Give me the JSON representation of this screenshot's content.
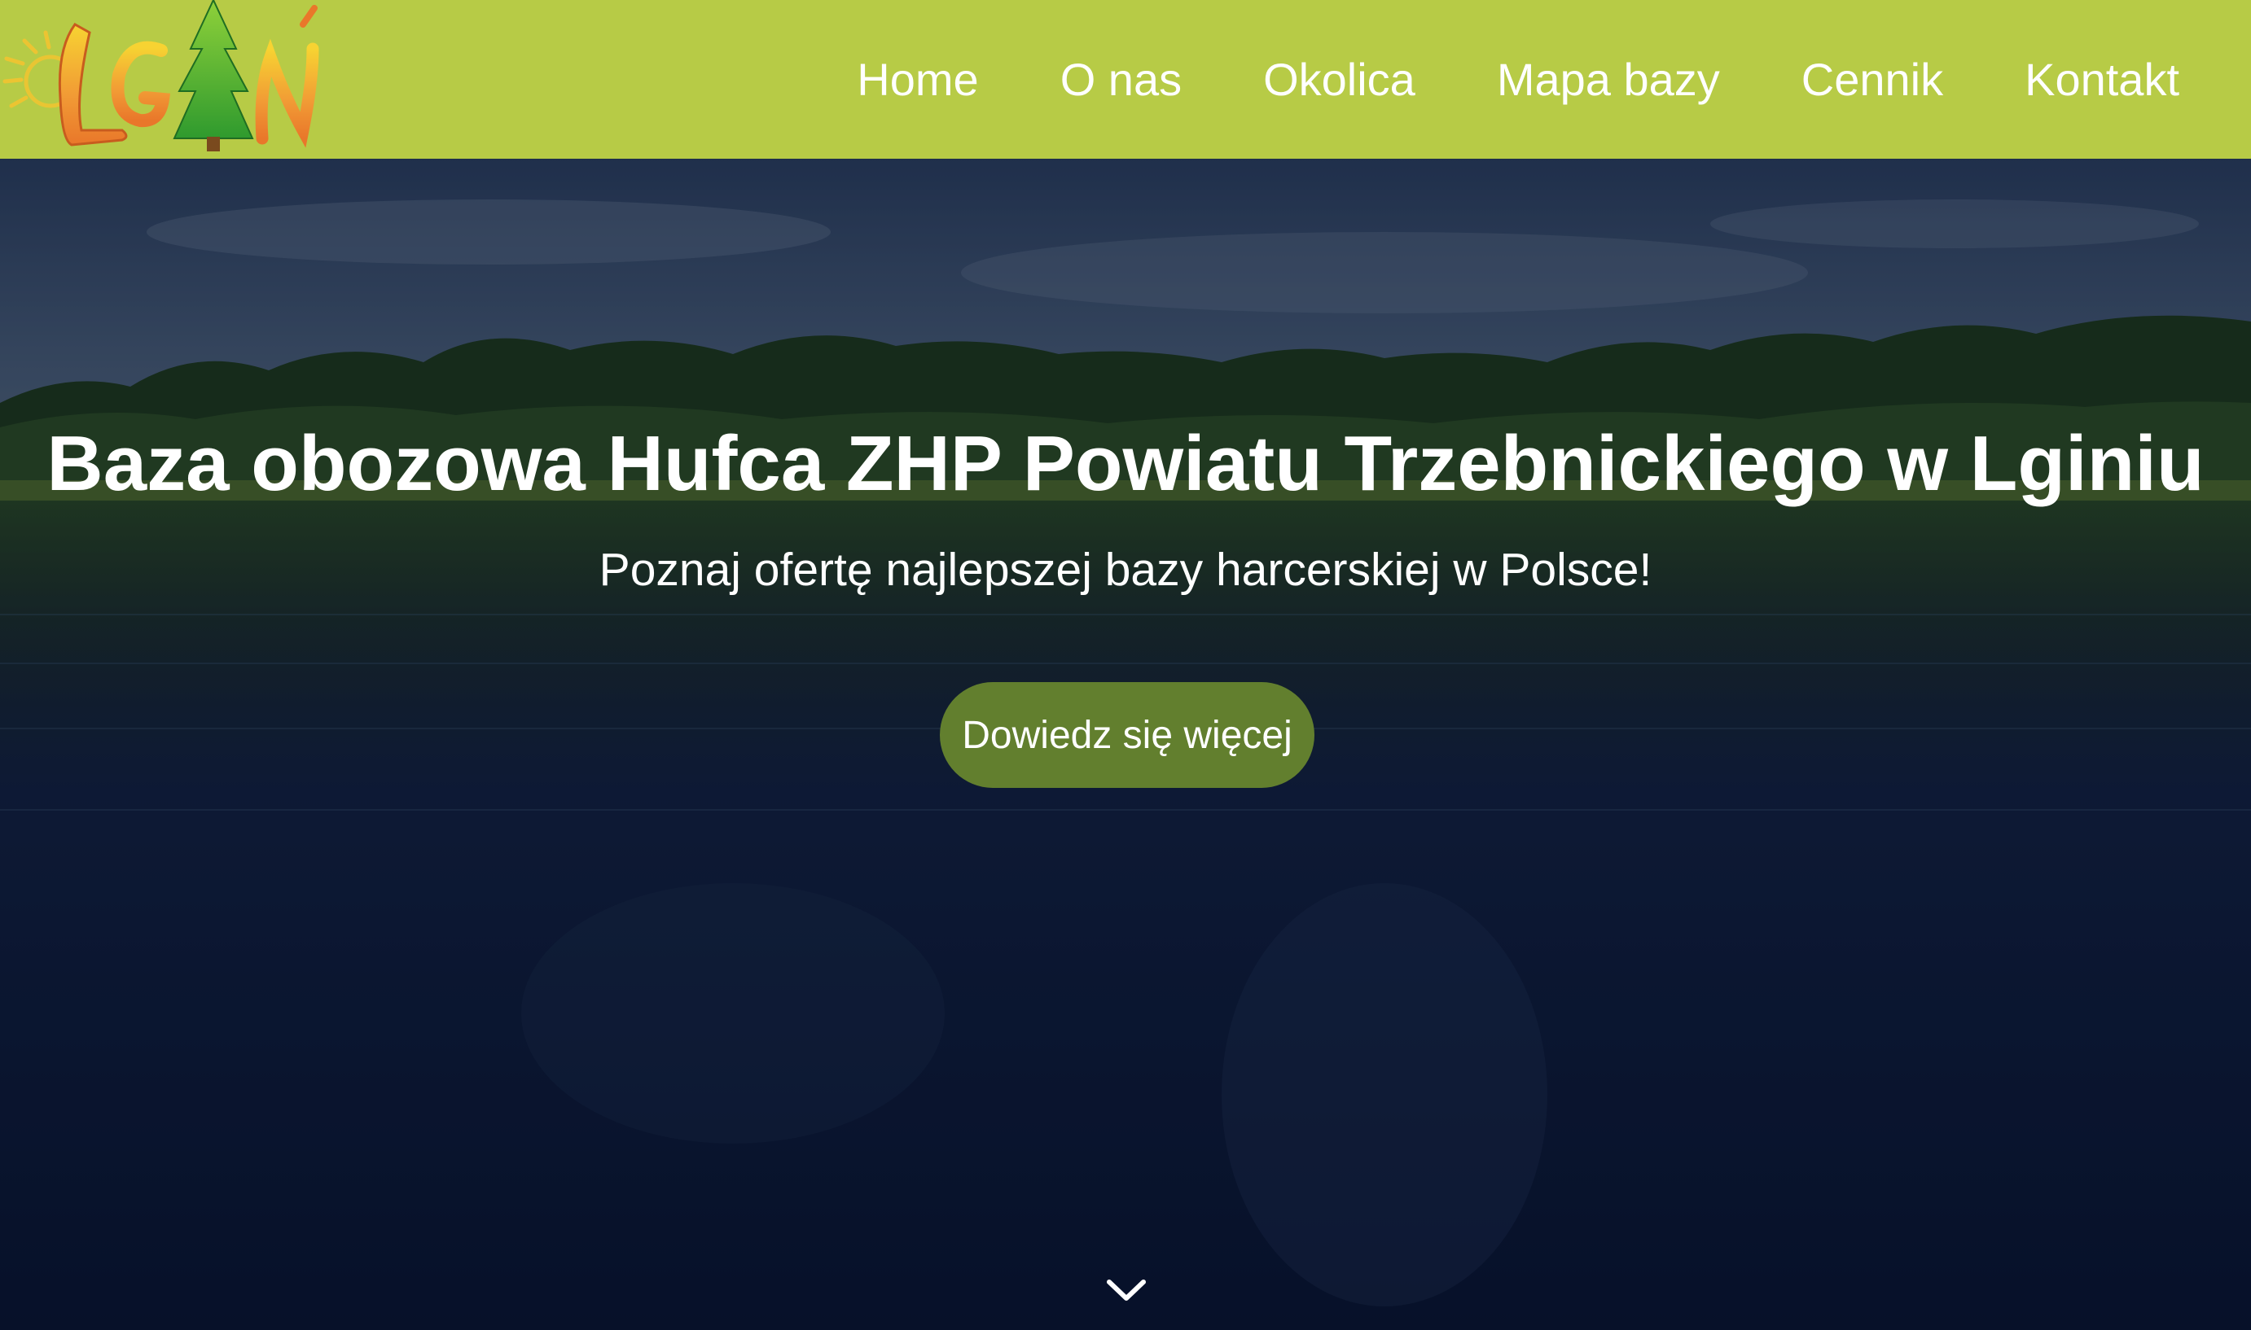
{
  "header": {
    "logo_text": "LGIŃ",
    "nav": [
      {
        "label": "Home"
      },
      {
        "label": "O nas"
      },
      {
        "label": "Okolica"
      },
      {
        "label": "Mapa bazy"
      },
      {
        "label": "Cennik"
      },
      {
        "label": "Kontakt"
      }
    ]
  },
  "hero": {
    "title": "Baza obozowa Hufca ZHP Powiatu Trzebnickiego w Lginiu",
    "subtitle": "Poznaj ofertę najlepszej bazy harcerskiej w Polsce!",
    "cta_label": "Dowiedz się więcej",
    "scroll_icon": "chevron-down-icon"
  },
  "colors": {
    "header_bg": "#b7cb46",
    "cta_bg": "#627f2e",
    "text": "#ffffff"
  }
}
